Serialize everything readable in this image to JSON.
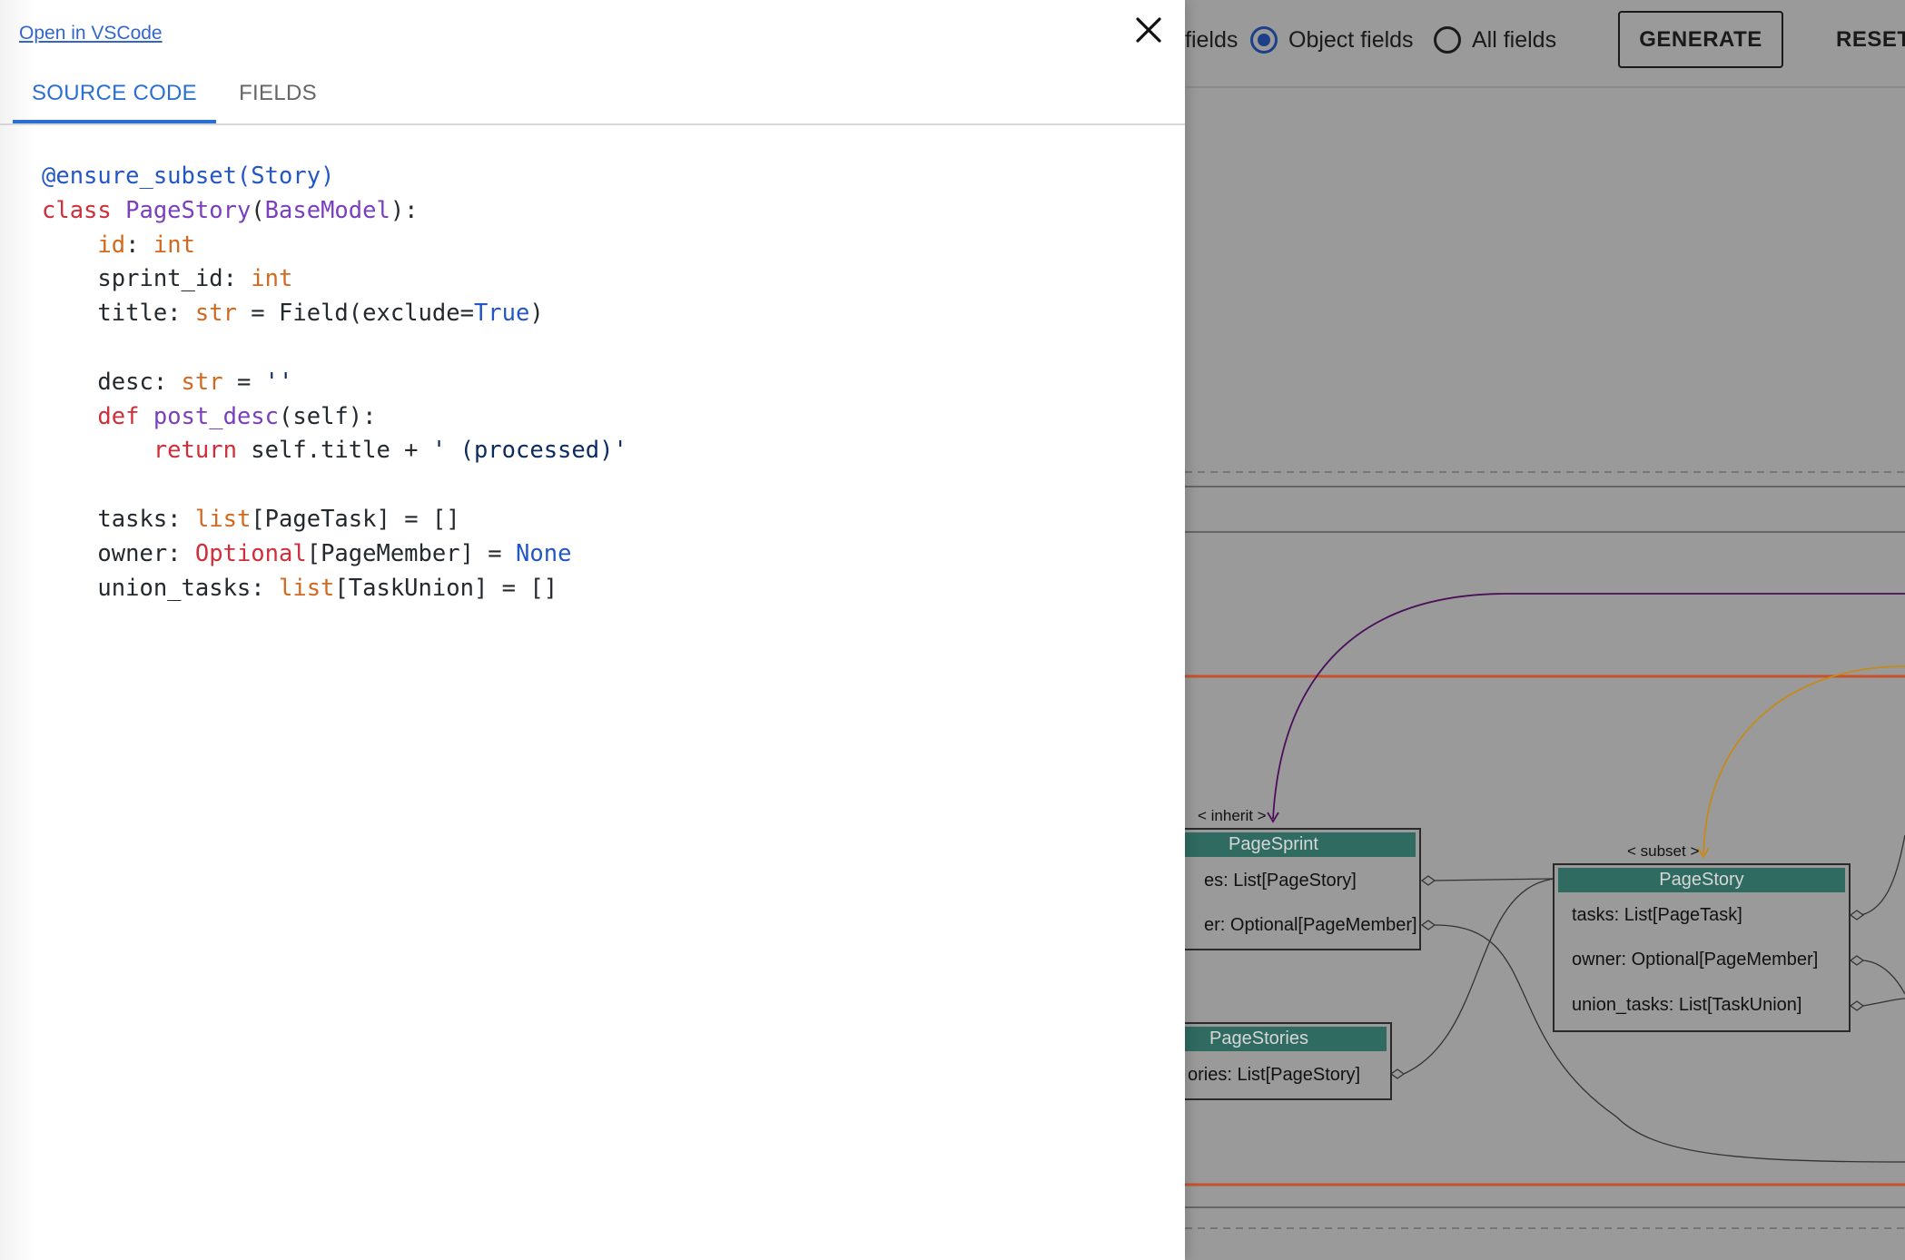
{
  "toolbar": {
    "radio_partial_label": "fields",
    "radio_object_label": "Object fields",
    "radio_all_label": "All fields",
    "generate_label": "GENERATE",
    "reset_label": "RESET",
    "selected": "Object fields"
  },
  "diagram": {
    "edge_labels": {
      "inherit": "< inherit >",
      "subset": "< subset >"
    },
    "nodes": [
      {
        "name": "PageSprint",
        "fields": [
          "es: List[PageStory]",
          "er: Optional[PageMember]"
        ]
      },
      {
        "name": "PageStories",
        "fields": [
          "ories: List[PageStory]"
        ]
      },
      {
        "name": "PageStory",
        "fields": [
          "tasks: List[PageTask]",
          "owner: Optional[PageMember]",
          "union_tasks: List[TaskUnion]"
        ]
      }
    ],
    "colors": {
      "inherit_edge": "#4b0f5a",
      "subset_edge": "#c58a1a",
      "header": "#2f6b60",
      "divider_red": "#c8502a"
    }
  },
  "drawer": {
    "vscode_link": "Open in VSCode",
    "close_icon": "close-icon",
    "tabs": [
      {
        "label": "SOURCE CODE",
        "active": true
      },
      {
        "label": "FIELDS",
        "active": false
      }
    ],
    "code_lines": [
      [
        [
          "dec",
          "@ensure_subset(Story)"
        ]
      ],
      [
        [
          "kw",
          "class "
        ],
        [
          "cls",
          "PageStory"
        ],
        [
          "",
          "("
        ],
        [
          "cls",
          "BaseModel"
        ],
        [
          "",
          "):"
        ]
      ],
      [
        [
          "",
          "    "
        ],
        [
          "ty",
          "id"
        ],
        [
          "",
          ": "
        ],
        [
          "ty",
          "int"
        ]
      ],
      [
        [
          "",
          "    sprint_id: "
        ],
        [
          "ty",
          "int"
        ]
      ],
      [
        [
          "",
          "    title: "
        ],
        [
          "ty",
          "str"
        ],
        [
          "",
          " = Field(exclude="
        ],
        [
          "bi",
          "True"
        ],
        [
          "",
          ")"
        ]
      ],
      [
        [
          "",
          ""
        ]
      ],
      [
        [
          "",
          "    desc: "
        ],
        [
          "ty",
          "str"
        ],
        [
          "",
          " = "
        ],
        [
          "str",
          "''"
        ]
      ],
      [
        [
          "",
          "    "
        ],
        [
          "kw",
          "def "
        ],
        [
          "fn",
          "post_desc"
        ],
        [
          "",
          "(self):"
        ]
      ],
      [
        [
          "",
          "        "
        ],
        [
          "kw",
          "return"
        ],
        [
          "",
          " self.title + "
        ],
        [
          "str",
          "' (processed)'"
        ]
      ],
      [
        [
          "",
          ""
        ]
      ],
      [
        [
          "",
          "    tasks: "
        ],
        [
          "ty",
          "list"
        ],
        [
          "",
          "[PageTask] = []"
        ]
      ],
      [
        [
          "",
          "    owner: "
        ],
        [
          "kw",
          "Optional"
        ],
        [
          "",
          "[PageMember] = "
        ],
        [
          "bi",
          "None"
        ]
      ],
      [
        [
          "",
          "    union_tasks: "
        ],
        [
          "ty",
          "list"
        ],
        [
          "",
          "[TaskUnion] = []"
        ]
      ]
    ]
  }
}
